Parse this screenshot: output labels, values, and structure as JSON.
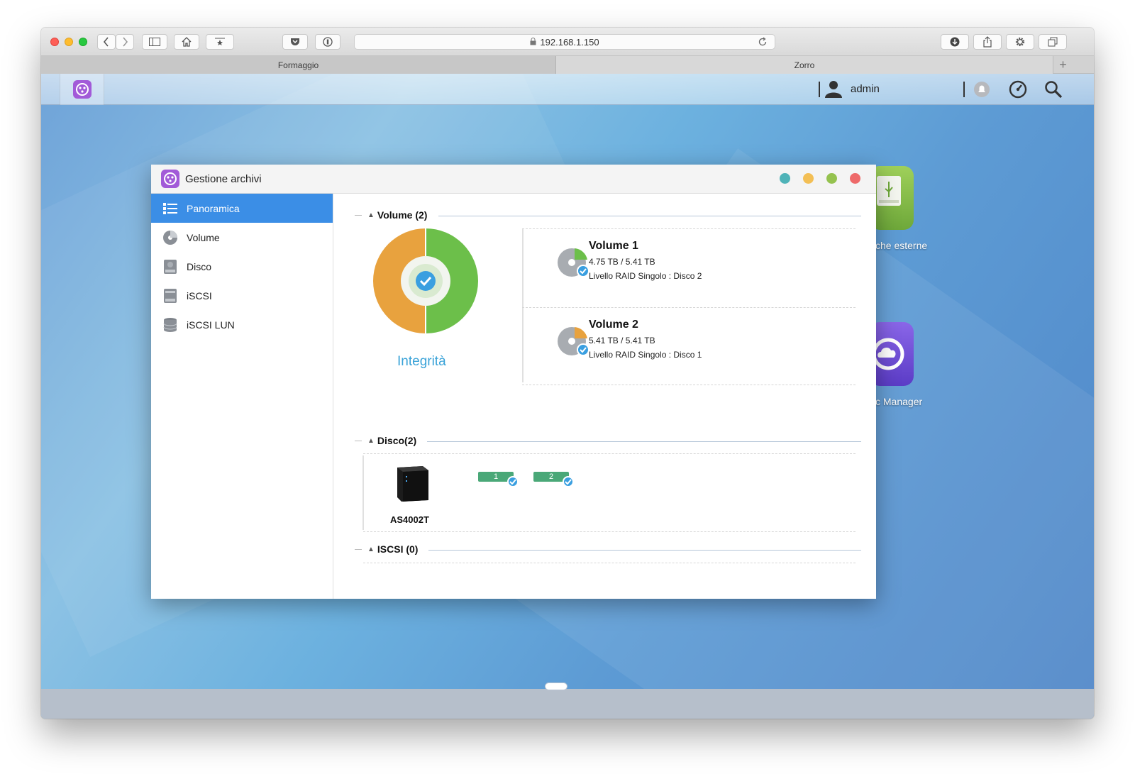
{
  "browser": {
    "address": "192.168.1.150",
    "tabs": [
      "Formaggio",
      "Zorro"
    ],
    "new_tab_label": "+"
  },
  "nas": {
    "user": "admin",
    "desktop_apps": [
      "che esterne",
      "c Manager"
    ]
  },
  "app": {
    "title": "Gestione archivi",
    "sidebar": [
      {
        "label": "Panoramica",
        "icon": "list-icon",
        "active": true
      },
      {
        "label": "Volume",
        "icon": "volume-icon",
        "active": false
      },
      {
        "label": "Disco",
        "icon": "disk-icon",
        "active": false
      },
      {
        "label": "iSCSI",
        "icon": "iscsi-icon",
        "active": false
      },
      {
        "label": "iSCSI LUN",
        "icon": "database-icon",
        "active": false
      }
    ],
    "volume_section": {
      "title": "Volume (2)",
      "integrity_label": "Integrità",
      "volumes": [
        {
          "name": "Volume 1",
          "size": "4.75 TB / 5.41 TB",
          "raid": "Livello RAID Singolo : Disco 2"
        },
        {
          "name": "Volume 2",
          "size": "5.41 TB / 5.41 TB",
          "raid": "Livello RAID Singolo : Disco 1"
        }
      ]
    },
    "disk_section": {
      "title": "Disco(2)",
      "device": "AS4002T",
      "disks": [
        "1",
        "2"
      ]
    },
    "iscsi_section": {
      "title": "ISCSI (0)"
    }
  },
  "colors": {
    "accent": "#3b8ee6",
    "integrity_orange": "#e8a23e",
    "integrity_green": "#6cbf4a",
    "disk_green": "#4aa878"
  }
}
